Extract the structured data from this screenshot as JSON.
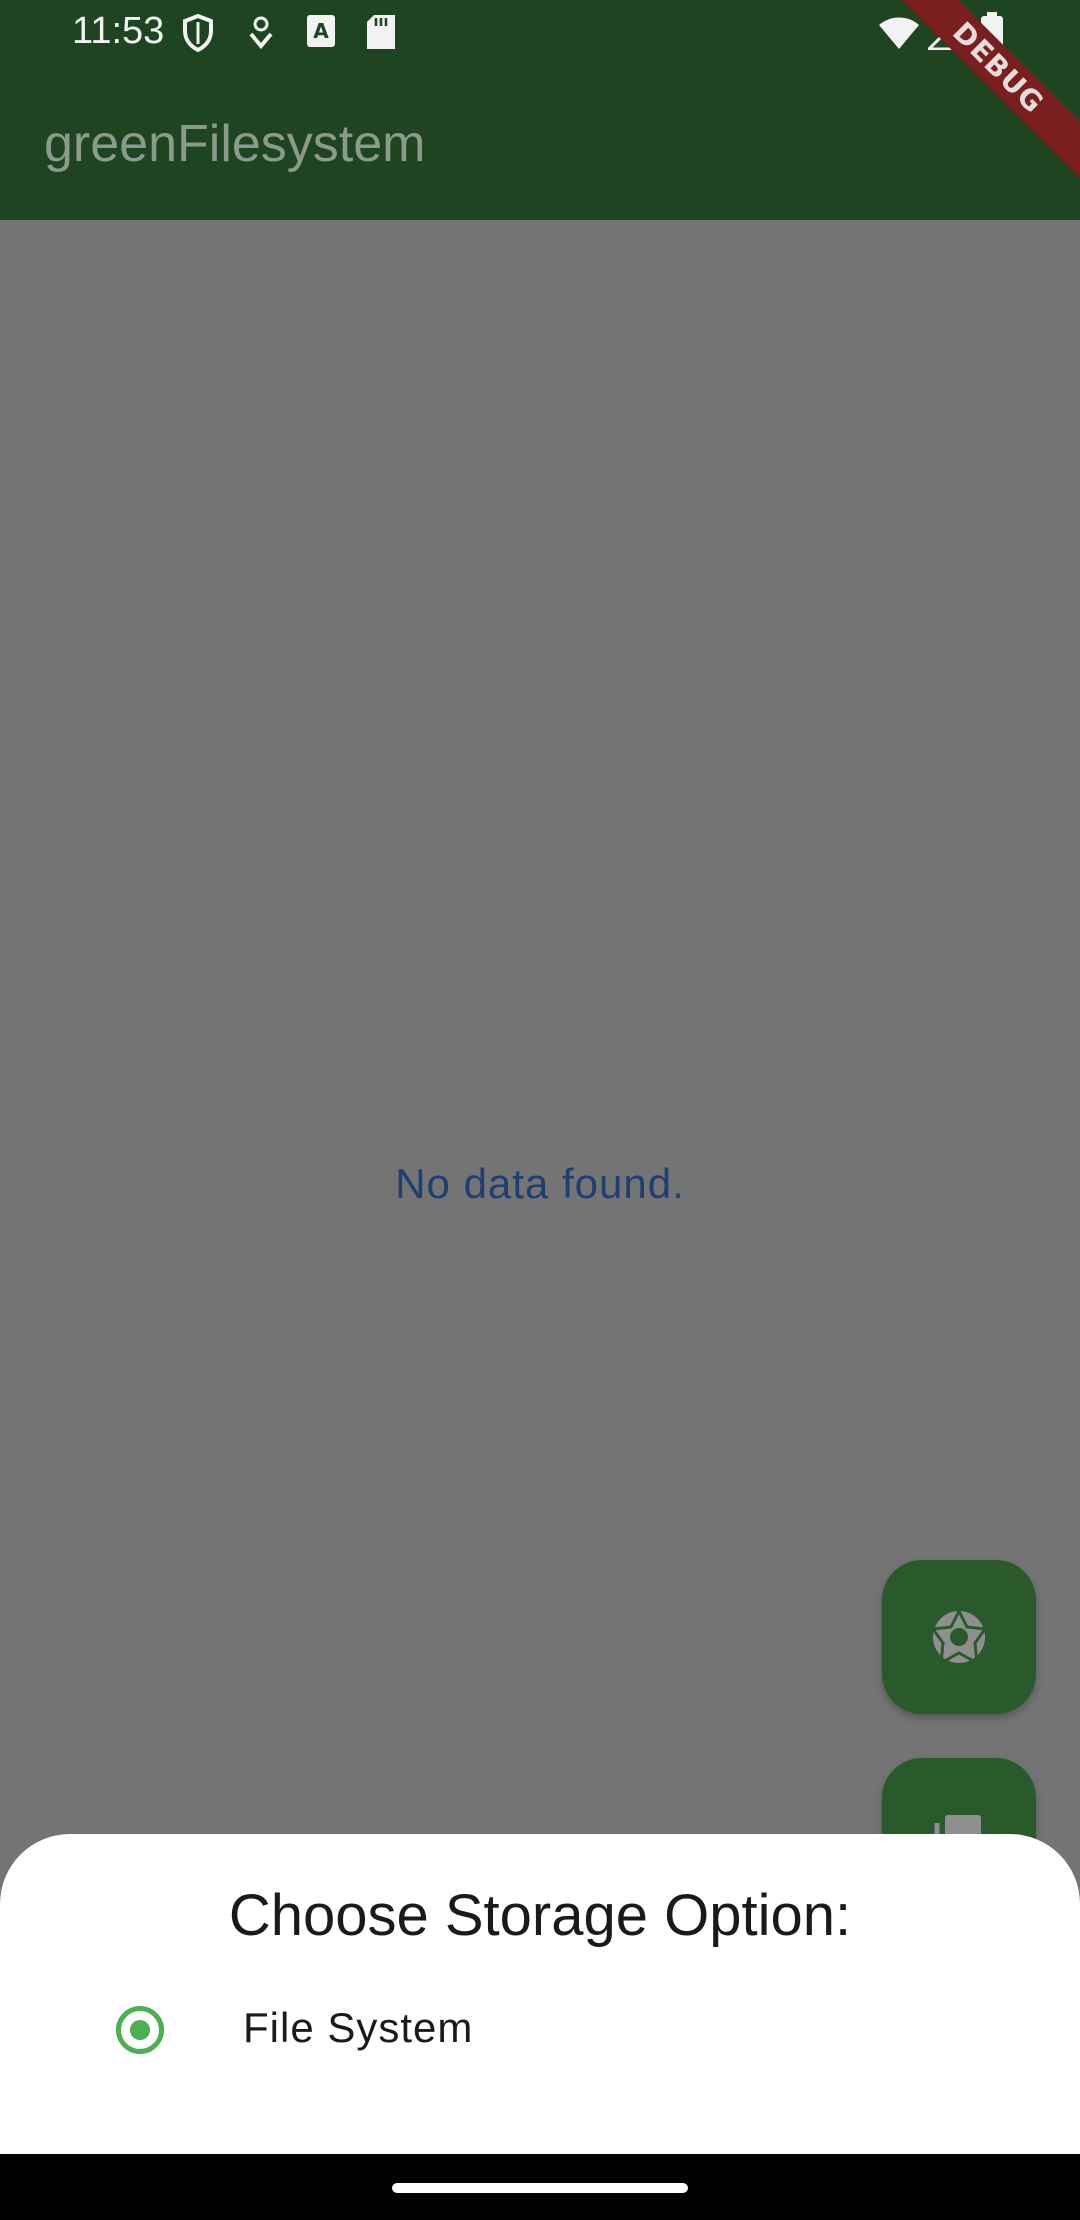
{
  "status_bar": {
    "time": "11:53",
    "icons": [
      "shield-icon",
      "download-icon",
      "a-icon",
      "sd-card-icon",
      "wifi-icon",
      "signal-icon",
      "battery-icon"
    ]
  },
  "app_bar": {
    "title": "greenFilesystem",
    "debug_label": "DEBUG",
    "color": "#1f4421"
  },
  "main": {
    "empty_message": "No data found.",
    "fabs": [
      {
        "name": "camera-button",
        "icon": "camera-aperture-icon"
      },
      {
        "name": "folder-button",
        "icon": "folder-icon"
      }
    ]
  },
  "bottom_sheet": {
    "title": "Choose Storage Option:",
    "options": [
      {
        "label": "File System",
        "selected": true
      }
    ],
    "accent": "#4caf50"
  }
}
